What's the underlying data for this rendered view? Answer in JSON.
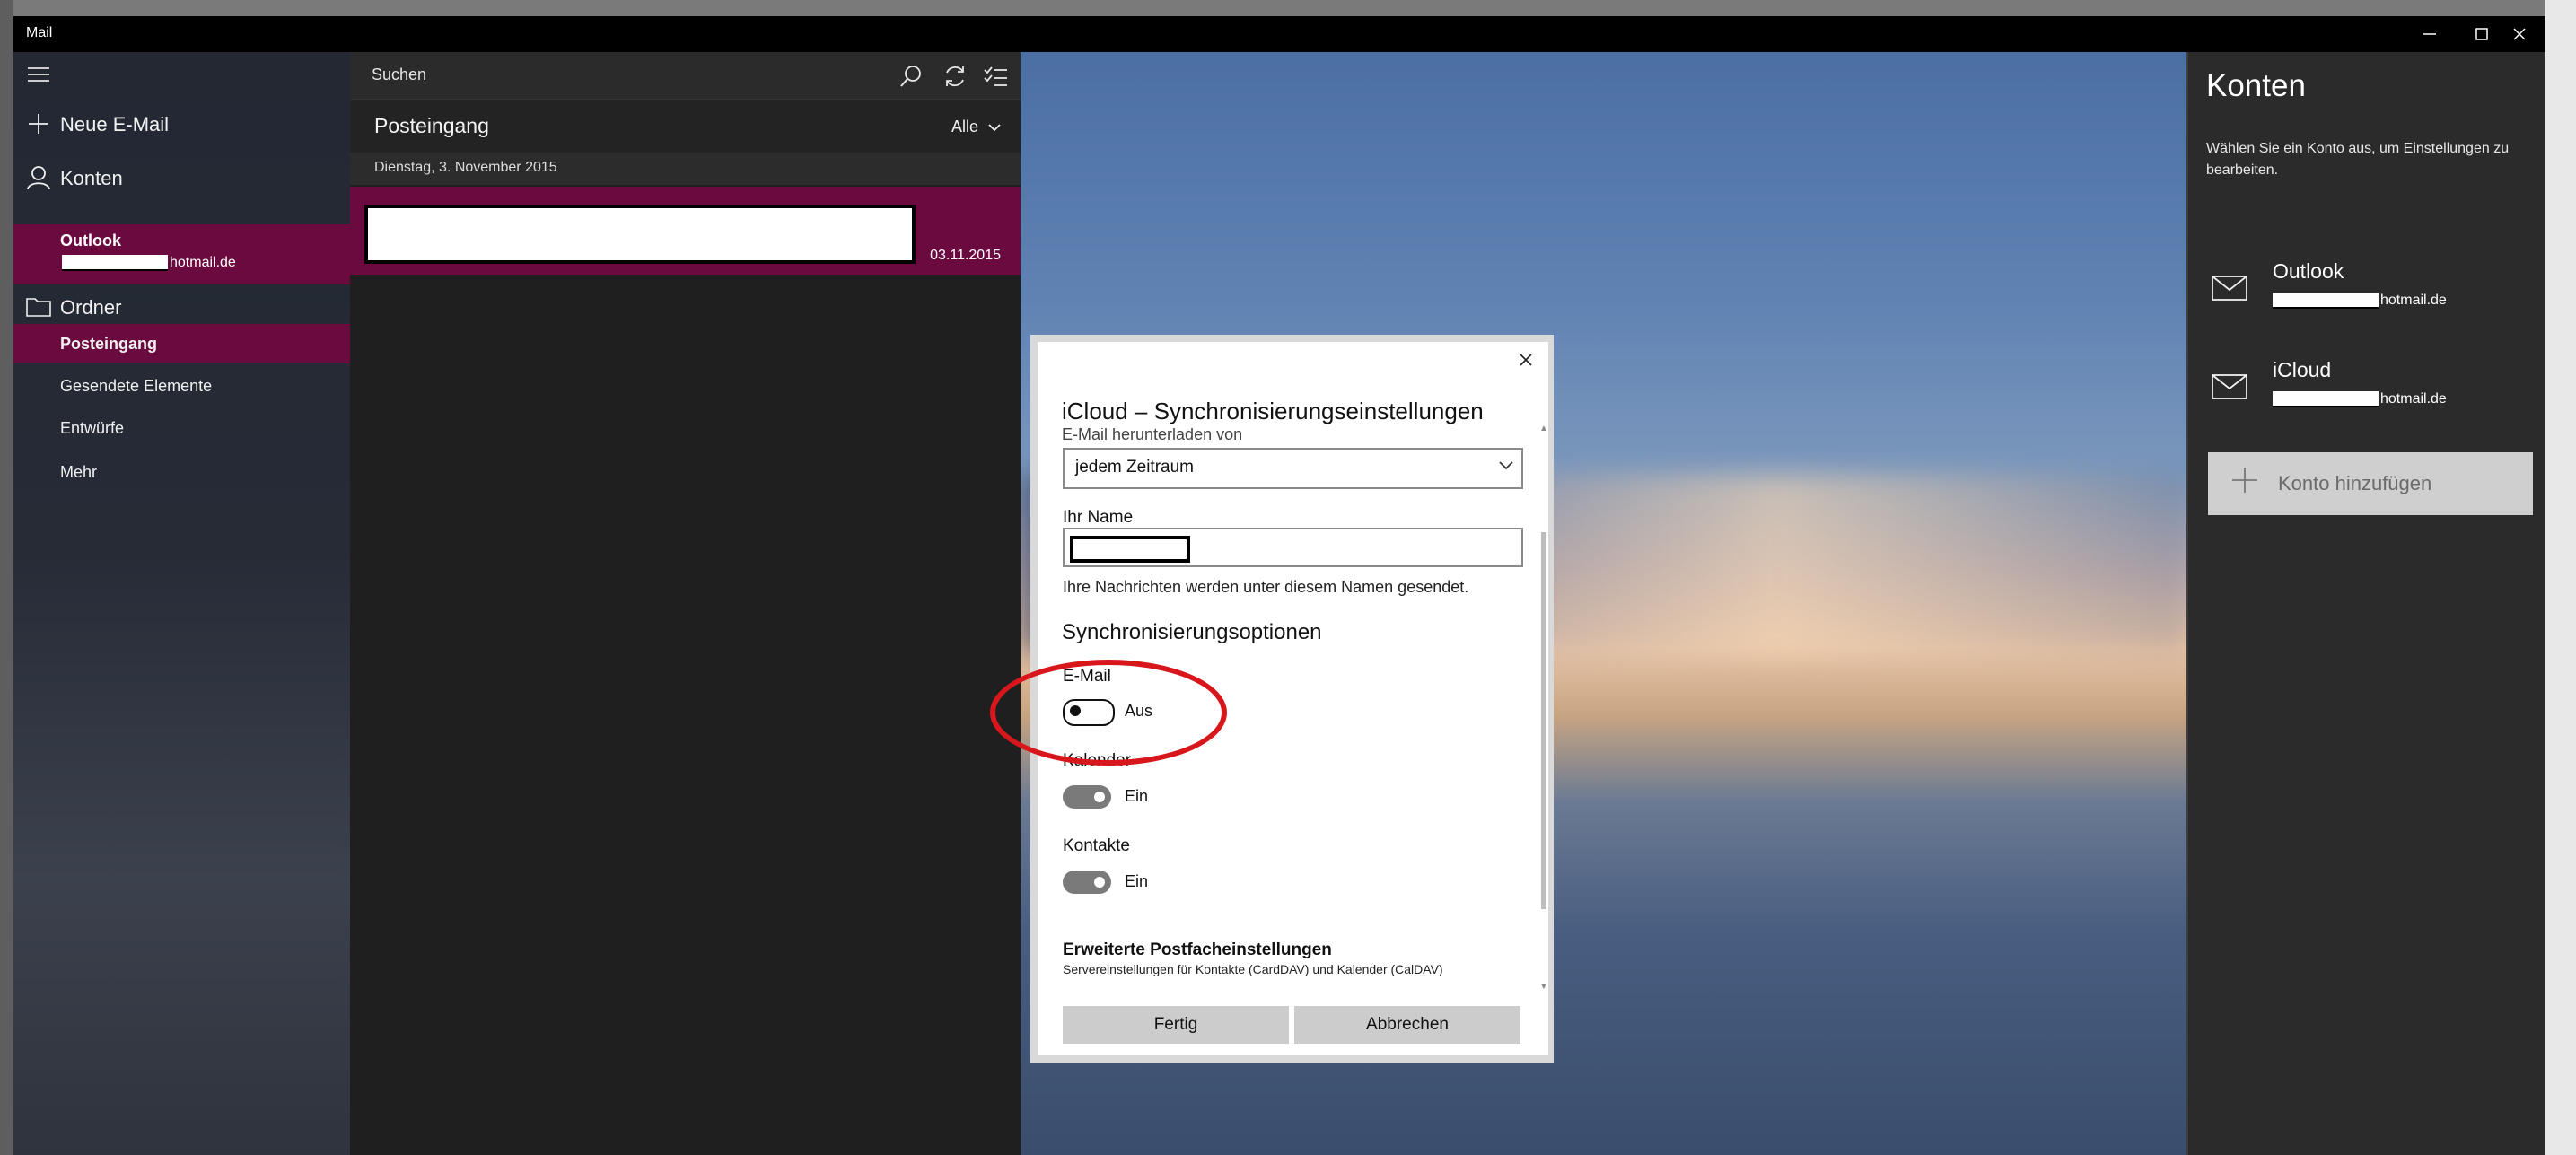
{
  "window": {
    "title": "Mail",
    "controls": {
      "minimize": "—",
      "maximize": "□",
      "close": "✕"
    }
  },
  "nav": {
    "new_mail": "Neue E-Mail",
    "accounts": "Konten",
    "selected_account": {
      "name": "Outlook",
      "email_suffix": "hotmail.de"
    },
    "folders_label": "Ordner",
    "folders": [
      "Posteingang",
      "Gesendete Elemente",
      "Entwürfe",
      "Mehr"
    ]
  },
  "list": {
    "search_placeholder": "Suchen",
    "inbox_title": "Posteingang",
    "filter": "Alle",
    "date_group": "Dienstag, 3. November 2015",
    "message_date": "03.11.2015"
  },
  "accounts_pane": {
    "title": "Konten",
    "description": "Wählen Sie ein Konto aus, um Einstellungen zu bearbeiten.",
    "items": [
      {
        "name": "Outlook",
        "email_suffix": "hotmail.de"
      },
      {
        "name": "iCloud",
        "email_suffix": "hotmail.de"
      }
    ],
    "add_account": "Konto hinzufügen"
  },
  "dialog": {
    "title": "iCloud – Synchronisierungseinstellungen",
    "download_label": "E-Mail herunterladen von",
    "download_value": "jedem Zeitraum",
    "name_label": "Ihr Name",
    "name_hint": "Ihre Nachrichten werden unter diesem Namen gesendet.",
    "sync_heading": "Synchronisierungsoptionen",
    "toggles": [
      {
        "label": "E-Mail",
        "state": "Aus",
        "on": false
      },
      {
        "label": "Kalender",
        "state": "Ein",
        "on": true
      },
      {
        "label": "Kontakte",
        "state": "Ein",
        "on": true
      }
    ],
    "advanced_title": "Erweiterte Postfacheinstellungen",
    "advanced_sub": "Servereinstellungen für Kontakte (CardDAV) und Kalender (CalDAV)",
    "done": "Fertig",
    "cancel": "Abbrechen"
  },
  "colors": {
    "accent": "#6b0a3e",
    "annotation": "#d8171d"
  }
}
